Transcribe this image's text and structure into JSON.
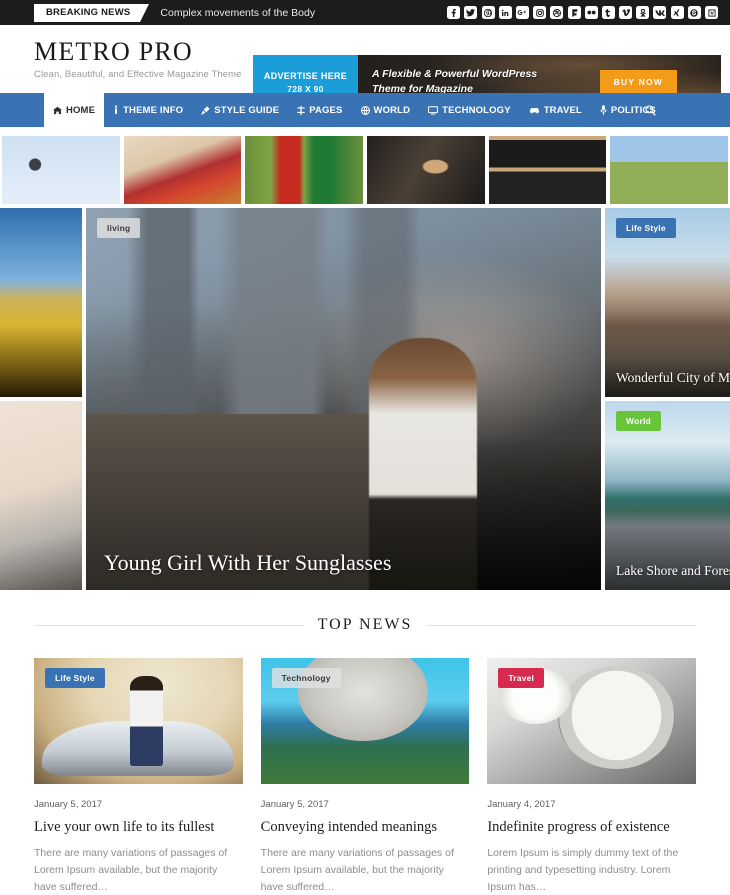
{
  "topbar": {
    "breaking_label": "BREAKING NEWS",
    "breaking_text": "Complex movements of the Body",
    "socials": [
      {
        "name": "facebook-icon",
        "glyph": "f"
      },
      {
        "name": "twitter-icon",
        "glyph": "✒"
      },
      {
        "name": "pinterest-icon",
        "glyph": "P"
      },
      {
        "name": "linkedin-icon",
        "glyph": "in"
      },
      {
        "name": "google-plus-icon",
        "glyph": "G+"
      },
      {
        "name": "instagram-icon",
        "glyph": "▣"
      },
      {
        "name": "dribbble-icon",
        "glyph": "●"
      },
      {
        "name": "foursquare-icon",
        "glyph": "F"
      },
      {
        "name": "flickr-icon",
        "glyph": "▪▪"
      },
      {
        "name": "tumblr-icon",
        "glyph": "t"
      },
      {
        "name": "vimeo-icon",
        "glyph": "v"
      },
      {
        "name": "odnoklassniki-icon",
        "glyph": "ø"
      },
      {
        "name": "vk-icon",
        "glyph": "w"
      },
      {
        "name": "xing-icon",
        "glyph": "X"
      },
      {
        "name": "skype-icon",
        "glyph": "S"
      },
      {
        "name": "vine-icon",
        "glyph": "V"
      }
    ]
  },
  "header": {
    "site_title": "METRO PRO",
    "tagline": "Clean, Beautiful, and Effective Magazine Theme",
    "ad": {
      "left_line1": "ADVERTISE HERE",
      "left_line2": "728 X 90",
      "copy_line1": "A Flexible & Powerful WordPress",
      "copy_line2": "Theme for Magazine",
      "button": "BUY NOW",
      "accent": "#1b9dd9",
      "button_color": "#f49b1a"
    }
  },
  "nav": {
    "accent": "#3a73b4",
    "items": [
      {
        "label": "HOME",
        "icon": "home-icon",
        "active": true
      },
      {
        "label": "THEME INFO",
        "icon": "info-icon",
        "active": false
      },
      {
        "label": "STYLE GUIDE",
        "icon": "brush-icon",
        "active": false
      },
      {
        "label": "PAGES",
        "icon": "pages-icon",
        "active": false
      },
      {
        "label": "WORLD",
        "icon": "globe-icon",
        "active": false
      },
      {
        "label": "TECHNOLOGY",
        "icon": "monitor-icon",
        "active": false
      },
      {
        "label": "TRAVEL",
        "icon": "car-icon",
        "active": false
      },
      {
        "label": "POLITICS",
        "icon": "microphone-icon",
        "active": false
      }
    ],
    "search_icon": "search-icon"
  },
  "thumbnail_strip": [
    {
      "name": "thumb-drone"
    },
    {
      "name": "thumb-woman-laptop"
    },
    {
      "name": "thumb-costumes-bench"
    },
    {
      "name": "thumb-speaker-man"
    },
    {
      "name": "thumb-stereo-receiver"
    },
    {
      "name": "thumb-guitar-field"
    }
  ],
  "hero": {
    "left_cells": [
      {
        "name": "hero-small-canola-field"
      },
      {
        "name": "hero-small-pencil-desk"
      }
    ],
    "main": {
      "badge": "living",
      "badge_color": "#e1e1e1",
      "title": "Young Girl With Her Sunglasses"
    },
    "right_cells": [
      {
        "badge": "Life Style",
        "badge_color": "#3a73b4",
        "title": "Wonderful City of Mik"
      },
      {
        "badge": "World",
        "badge_color": "#67c53a",
        "title": "Lake Shore and Forest"
      }
    ]
  },
  "top_news": {
    "section_title": "TOP NEWS",
    "cards": [
      {
        "badge": "Life Style",
        "badge_color": "#3a73b4",
        "date": "January 5, 2017",
        "title": "Live your own life to its fullest",
        "excerpt": "There are many variations of passages of Lorem Ipsum available, but the majority have suffered…"
      },
      {
        "badge": "Technology",
        "badge_color": "#b9b9b9",
        "date": "January 5, 2017",
        "title": "Conveying intended meanings",
        "excerpt": "There are many variations of passages of Lorem Ipsum available, but the majority have suffered…"
      },
      {
        "badge": "Travel",
        "badge_color": "#d62b4f",
        "date": "January 4, 2017",
        "title": "Indefinite progress of existence",
        "excerpt": "Lorem Ipsum is simply dummy text of the printing and typesetting industry. Lorem Ipsum has…"
      }
    ]
  }
}
